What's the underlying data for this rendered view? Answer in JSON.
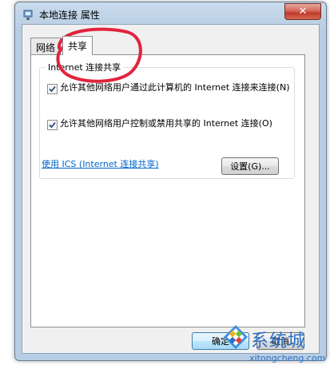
{
  "window": {
    "title": "本地连接 属性",
    "close_label": "✕"
  },
  "tabs": [
    {
      "label": "网络",
      "active": false
    },
    {
      "label": "共享",
      "active": true
    }
  ],
  "ics_group": {
    "label": "Internet 连接共享",
    "options": [
      {
        "text": "允许其他网络用户通过此计算机的 Internet 连接来连接(N)",
        "checked": true
      },
      {
        "text": "允许其他网络用户控制或禁用共享的 Internet 连接(O)",
        "checked": true
      }
    ],
    "link_text": "使用 ICS (Internet 连接共享)",
    "settings_button": "设置(G)..."
  },
  "footer": {
    "ok_button": "确定",
    "cancel_button": "取消"
  },
  "watermark": {
    "brand": "系统城",
    "url": "xitongcheng.com"
  },
  "colors": {
    "annotation": "#e0243c",
    "link": "#0066cc",
    "watermark": "#2a6ec4"
  },
  "icons": {
    "title": "network-adapter-icon",
    "watermark": "windows-logo-icon"
  }
}
